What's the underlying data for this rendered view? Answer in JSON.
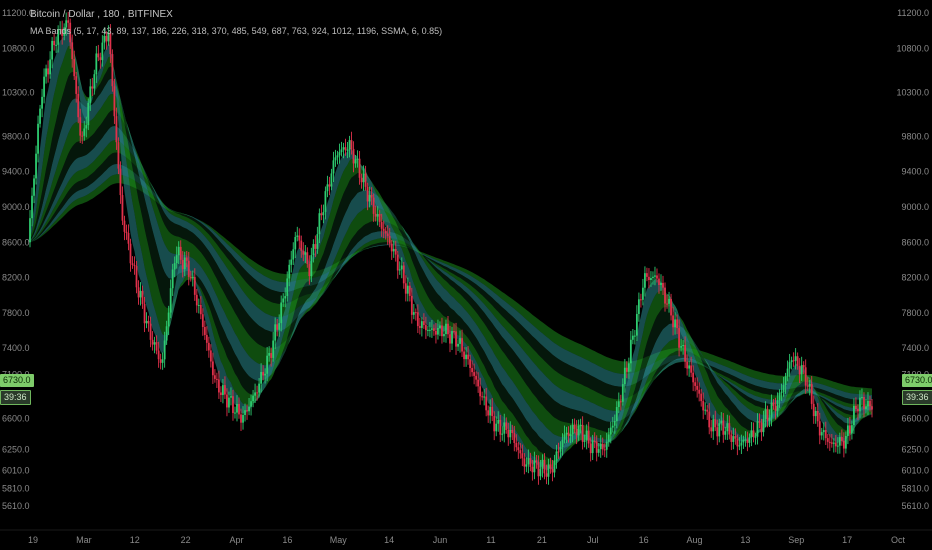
{
  "header": {
    "symbol": "Bitcoin / Dollar",
    "interval": "180",
    "exchange": "BITFINEX",
    "indicator": "MA Bands (5, 17, 43, 89, 137, 186, 226, 318, 370, 485, 549, 687, 763, 924, 1012, 1196, SSMA, 6, 0.85)"
  },
  "price_axis": {
    "ticks": [
      "11200.0",
      "10800.0",
      "10300.0",
      "9800.0",
      "9400.0",
      "9000.0",
      "8600.0",
      "8200.0",
      "7800.0",
      "7400.0",
      "7100.0",
      "6600.0",
      "6250.0",
      "6010.0",
      "5810.0",
      "5610.0"
    ],
    "current_price": "6730.0",
    "countdown": "39:36"
  },
  "time_axis": {
    "labels": [
      "19",
      "Mar",
      "12",
      "22",
      "Apr",
      "16",
      "May",
      "14",
      "Jun",
      "11",
      "21",
      "Jul",
      "16",
      "Aug",
      "13",
      "Sep",
      "17",
      "Oct"
    ]
  },
  "colors": {
    "background": "#000000",
    "up": "#2ecc71",
    "down": "#e0314b",
    "band_teal": "#2a8a8c",
    "band_green": "#1b8a1b",
    "band_dark": "#0a2a14"
  },
  "chart_data": {
    "type": "line",
    "title": "",
    "ylim": [
      5450,
      11280
    ],
    "series": [
      {
        "values": [
          8600,
          10300,
          10900,
          11100,
          9700,
          10600,
          11000,
          8900,
          8200,
          7600,
          7200,
          8500,
          8300,
          7700,
          7000,
          6800,
          6600,
          6900,
          7300,
          7900,
          8700,
          8300,
          9000,
          9600,
          9700,
          9300,
          8900,
          8600,
          8200,
          7700,
          7600,
          7600,
          7500,
          7200,
          6800,
          6500,
          6450,
          6100,
          6050,
          6000,
          6400,
          6500,
          6300,
          6250,
          6700,
          7400,
          8200,
          8200,
          7800,
          7300,
          6900,
          6500,
          6500,
          6300,
          6400,
          6600,
          6800,
          7300,
          7100,
          6500,
          6300,
          6350,
          6800,
          6730
        ]
      }
    ]
  }
}
